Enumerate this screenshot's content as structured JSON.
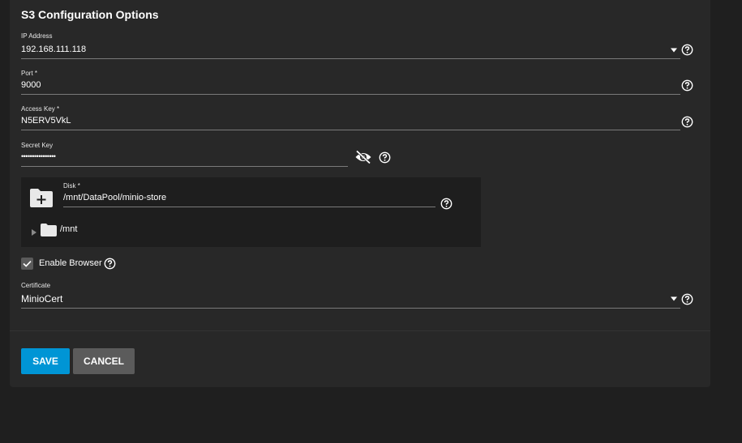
{
  "section_title": "S3 Configuration Options",
  "fields": {
    "ip_address": {
      "label": "IP Address",
      "value": "192.168.111.118"
    },
    "port": {
      "label": "Port *",
      "value": "9000"
    },
    "access_key": {
      "label": "Access Key *",
      "value": "N5ERV5VkL"
    },
    "secret_key": {
      "label": "Secret Key",
      "value": "••••••••••••••••"
    },
    "disk": {
      "label": "Disk *",
      "value": "/mnt/DataPool/minio-store"
    },
    "certificate": {
      "label": "Certificate",
      "value": "MinioCert"
    }
  },
  "explorer": {
    "tree_root": "/mnt"
  },
  "enable_browser": {
    "label": "Enable Browser",
    "checked": true
  },
  "buttons": {
    "save": "SAVE",
    "cancel": "CANCEL"
  },
  "icons": {
    "help": "help-circle-icon",
    "dropdown": "caret-down-icon",
    "visibility": "eye-off-icon",
    "folder_add": "folder-plus-icon",
    "folder": "folder-icon",
    "tree_toggle": "triangle-right-icon",
    "check": "check-icon"
  },
  "colors": {
    "primary": "#0095d5",
    "background": "#1f1f1f",
    "card": "#282828",
    "explorer_bg": "#1e1e1e",
    "cancel": "#5b5b5b"
  }
}
